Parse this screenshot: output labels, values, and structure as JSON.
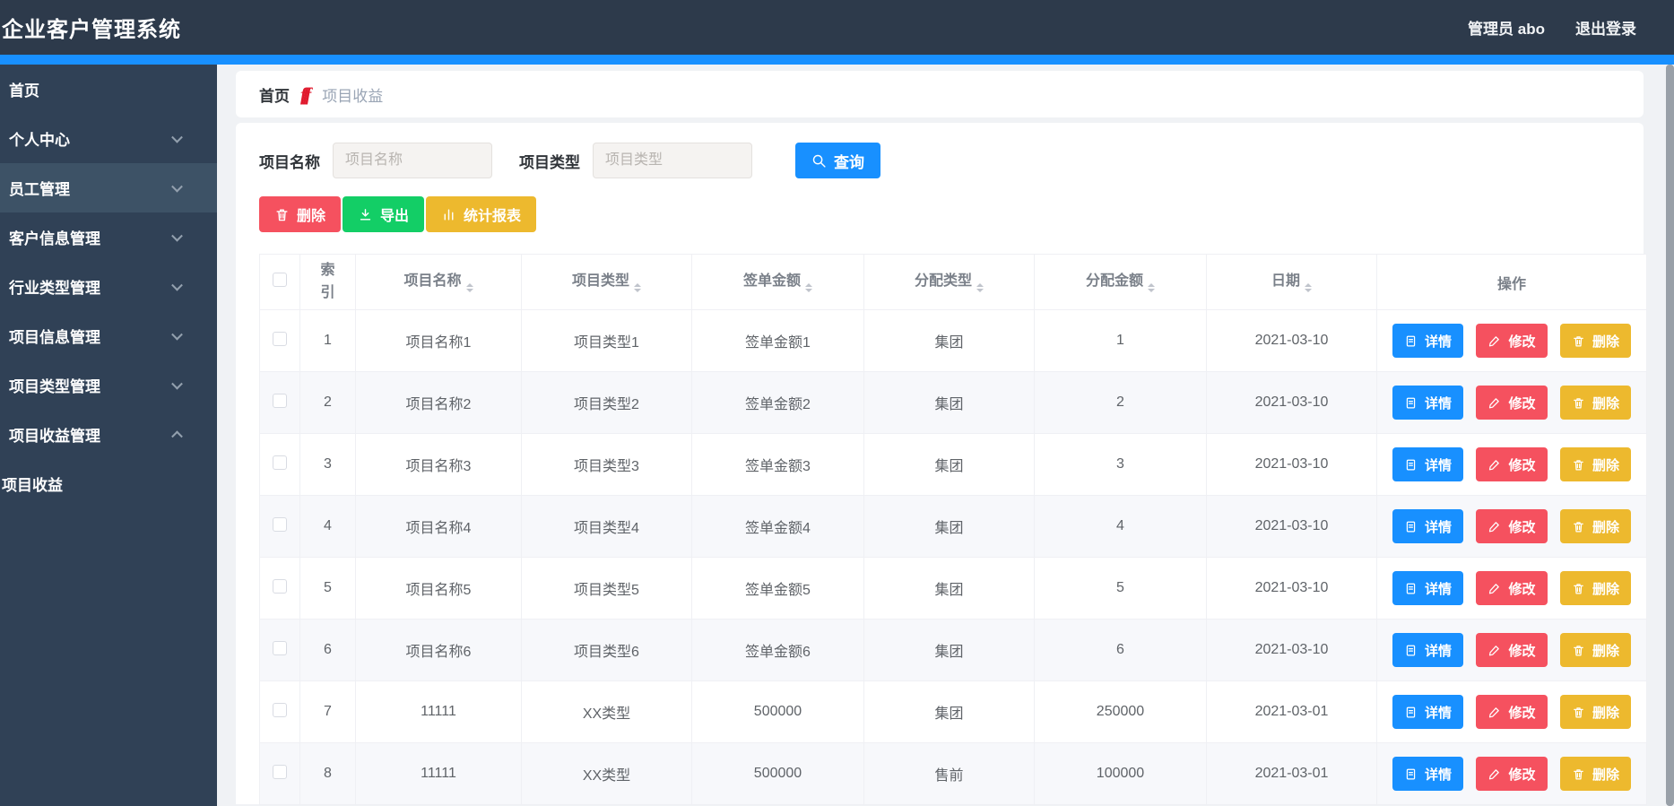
{
  "navbar": {
    "title": "企业客户管理系统",
    "user": "管理员 abo",
    "logout": "退出登录"
  },
  "sidebar": {
    "items": [
      {
        "id": "home",
        "label": "首页",
        "arrow": "none",
        "active": false,
        "submenu": false
      },
      {
        "id": "personal-center",
        "label": "个人中心",
        "arrow": "down",
        "active": false,
        "submenu": false
      },
      {
        "id": "employee-mgmt",
        "label": "员工管理",
        "arrow": "down",
        "active": true,
        "submenu": false
      },
      {
        "id": "customer-info-mgmt",
        "label": "客户信息管理",
        "arrow": "down",
        "active": false,
        "submenu": false
      },
      {
        "id": "industry-type-mgmt",
        "label": "行业类型管理",
        "arrow": "down",
        "active": false,
        "submenu": false
      },
      {
        "id": "project-info-mgmt",
        "label": "项目信息管理",
        "arrow": "down",
        "active": false,
        "submenu": false
      },
      {
        "id": "project-type-mgmt",
        "label": "项目类型管理",
        "arrow": "down",
        "active": false,
        "submenu": false
      },
      {
        "id": "project-income-mgmt",
        "label": "项目收益管理",
        "arrow": "up",
        "active": false,
        "submenu": false
      },
      {
        "id": "project-income",
        "label": "项目收益",
        "arrow": "none",
        "active": false,
        "submenu": true
      }
    ]
  },
  "breadcrumb": {
    "home": "首页",
    "separator": "fff",
    "current": "项目收益"
  },
  "filters": {
    "name_label": "项目名称",
    "name_placeholder": "项目名称",
    "name_value": "",
    "type_label": "项目类型",
    "type_placeholder": "项目类型",
    "type_value": "",
    "search_label": "查询"
  },
  "toolbar": {
    "delete_label": "删除",
    "export_label": "导出",
    "report_label": "统计报表"
  },
  "table": {
    "columns": [
      {
        "label": "索引",
        "sortable": false,
        "wrap": true
      },
      {
        "label": "项目名称",
        "sortable": true,
        "wrap": false
      },
      {
        "label": "项目类型",
        "sortable": true,
        "wrap": false
      },
      {
        "label": "签单金额",
        "sortable": true,
        "wrap": false
      },
      {
        "label": "分配类型",
        "sortable": true,
        "wrap": false
      },
      {
        "label": "分配金额",
        "sortable": true,
        "wrap": false
      },
      {
        "label": "日期",
        "sortable": true,
        "wrap": false
      },
      {
        "label": "操作",
        "sortable": false,
        "wrap": false
      }
    ],
    "rows": [
      {
        "index": "1",
        "name": "项目名称1",
        "type": "项目类型1",
        "amount": "签单金额1",
        "alloc_type": "集团",
        "alloc_amount": "1",
        "date": "2021-03-10"
      },
      {
        "index": "2",
        "name": "项目名称2",
        "type": "项目类型2",
        "amount": "签单金额2",
        "alloc_type": "集团",
        "alloc_amount": "2",
        "date": "2021-03-10"
      },
      {
        "index": "3",
        "name": "项目名称3",
        "type": "项目类型3",
        "amount": "签单金额3",
        "alloc_type": "集团",
        "alloc_amount": "3",
        "date": "2021-03-10"
      },
      {
        "index": "4",
        "name": "项目名称4",
        "type": "项目类型4",
        "amount": "签单金额4",
        "alloc_type": "集团",
        "alloc_amount": "4",
        "date": "2021-03-10"
      },
      {
        "index": "5",
        "name": "项目名称5",
        "type": "项目类型5",
        "amount": "签单金额5",
        "alloc_type": "集团",
        "alloc_amount": "5",
        "date": "2021-03-10"
      },
      {
        "index": "6",
        "name": "项目名称6",
        "type": "项目类型6",
        "amount": "签单金额6",
        "alloc_type": "集团",
        "alloc_amount": "6",
        "date": "2021-03-10"
      },
      {
        "index": "7",
        "name": "11111",
        "type": "XX类型",
        "amount": "500000",
        "alloc_type": "集团",
        "alloc_amount": "250000",
        "date": "2021-03-01"
      },
      {
        "index": "8",
        "name": "11111",
        "type": "XX类型",
        "amount": "500000",
        "alloc_type": "售前",
        "alloc_amount": "100000",
        "date": "2021-03-01"
      }
    ],
    "row_actions": {
      "detail_label": "详情",
      "edit_label": "修改",
      "delete_label": "删除"
    }
  },
  "colors": {
    "primary": "#1890ff",
    "danger": "#f5515f",
    "success": "#13ce66",
    "warning": "#edb92e",
    "navbar_bg": "#2d3a4b",
    "sidebar_bg": "#304156",
    "sidebar_active_bg": "#3d5266",
    "page_bg": "#f0f2f5",
    "breadcrumb_icon": "#e0192d",
    "table_border": "#eff0f4",
    "zebra_row_bg": "#f7f8fb"
  }
}
